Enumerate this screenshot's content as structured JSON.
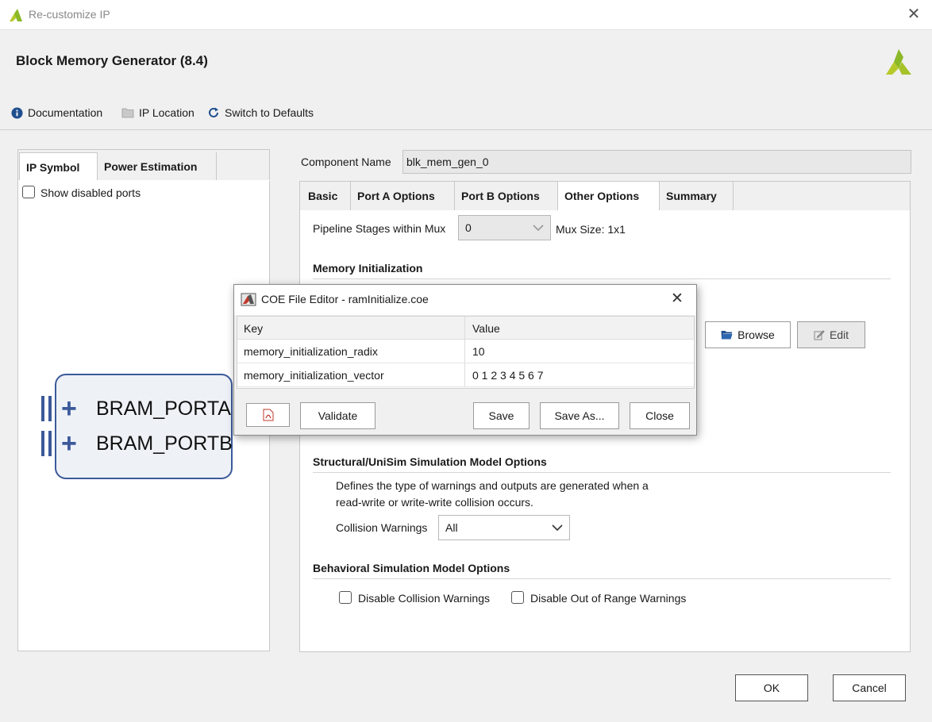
{
  "window": {
    "title": "Re-customize IP",
    "close_glyph": "✕"
  },
  "header": {
    "title": "Block Memory Generator (8.4)",
    "toolbar": [
      {
        "label": "Documentation",
        "icon": "info-icon"
      },
      {
        "label": "IP Location",
        "icon": "folder-icon"
      },
      {
        "label": "Switch to Defaults",
        "icon": "refresh-icon"
      }
    ]
  },
  "left_panel": {
    "tabs": [
      "IP Symbol",
      "Power Estimation"
    ],
    "active_tab": "IP Symbol",
    "show_disabled_ports_label": "Show disabled ports",
    "show_disabled_ports_checked": false,
    "ports": [
      {
        "label": "BRAM_PORTA"
      },
      {
        "label": "BRAM_PORTB"
      }
    ]
  },
  "component": {
    "label": "Component Name",
    "value": "blk_mem_gen_0"
  },
  "right_tabs": [
    "Basic",
    "Port A Options",
    "Port B Options",
    "Other Options",
    "Summary"
  ],
  "active_right_tab": "Other Options",
  "other_options": {
    "pipeline_label": "Pipeline Stages within Mux",
    "pipeline_value": "0",
    "mux_size": "Mux Size: 1x1",
    "memory_init_title": "Memory Initialization",
    "browse_label": "Browse",
    "edit_label": "Edit",
    "structural_title": "Structural/UniSim Simulation Model Options",
    "structural_desc_line1": "Defines the type of warnings and outputs are generated when a",
    "structural_desc_line2": "read-write or write-write collision occurs.",
    "collision_label": "Collision Warnings",
    "collision_value": "All",
    "behavioral_title": "Behavioral Simulation Model Options",
    "disable_collision_label": "Disable Collision Warnings",
    "disable_out_of_range_label": "Disable Out of Range Warnings"
  },
  "coe_editor": {
    "title": "COE File Editor - ramInitialize.coe",
    "close_glyph": "✕",
    "columns": [
      "Key",
      "Value"
    ],
    "rows": [
      {
        "key": "memory_initialization_radix",
        "value": "10"
      },
      {
        "key": "memory_initialization_vector",
        "value": "0 1 2 3 4 5 6 7"
      }
    ],
    "buttons": {
      "validate": "Validate",
      "save": "Save",
      "save_as": "Save As...",
      "close": "Close"
    }
  },
  "footer": {
    "ok": "OK",
    "cancel": "Cancel"
  },
  "colors": {
    "accent_blue": "#3c5a9a",
    "brand_green": "#8ab827"
  }
}
